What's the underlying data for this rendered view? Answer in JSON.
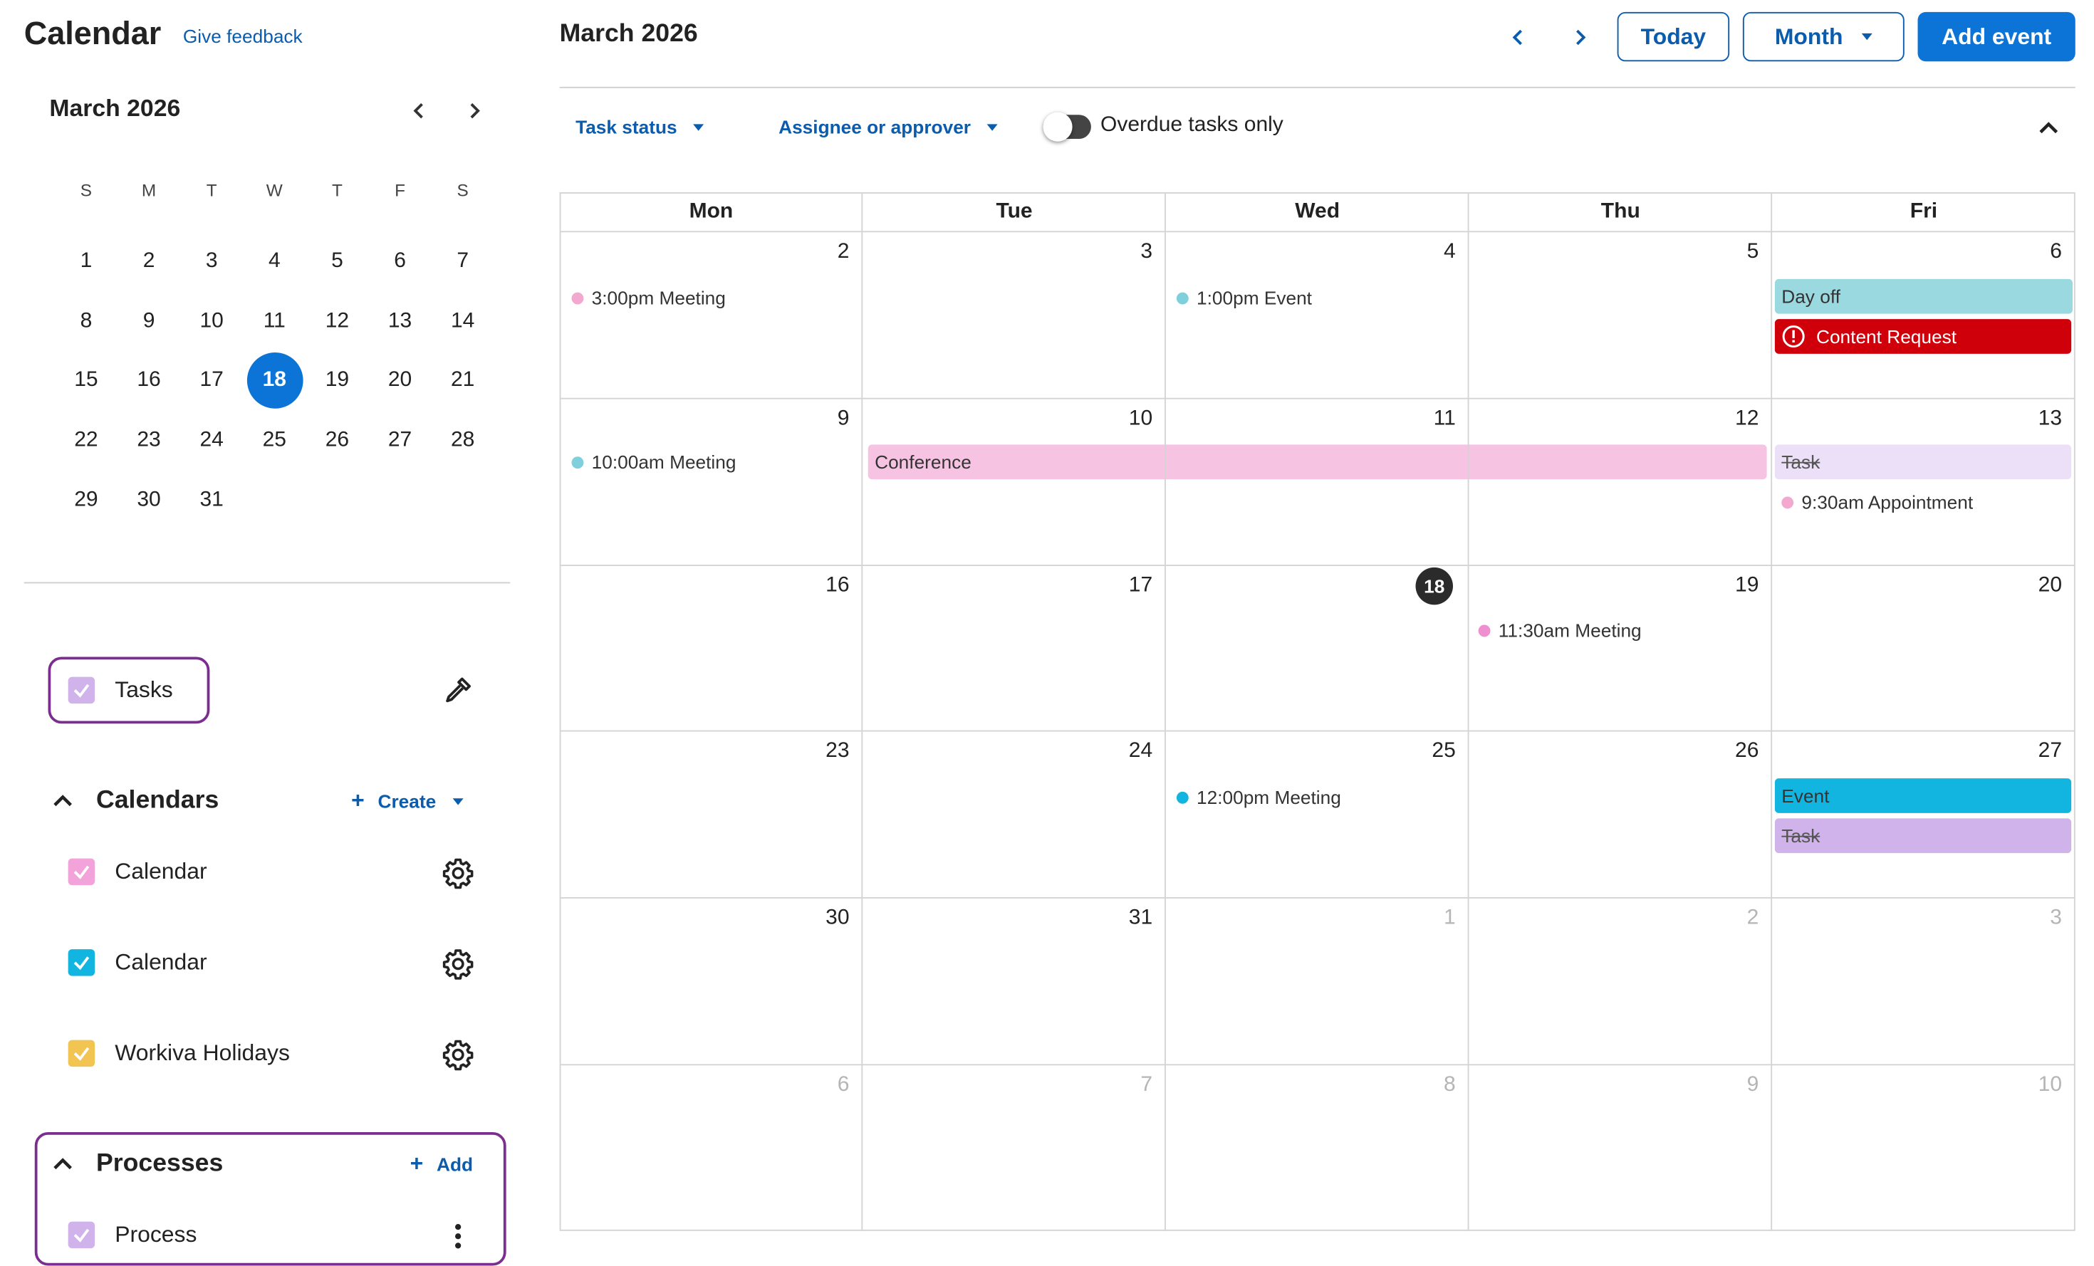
{
  "sidebar": {
    "app_title": "Calendar",
    "feedback_link": "Give feedback",
    "mini_calendar": {
      "title": "March 2026",
      "weekday_headers": [
        "S",
        "M",
        "T",
        "W",
        "T",
        "F",
        "S"
      ],
      "days": [
        "1",
        "2",
        "3",
        "4",
        "5",
        "6",
        "7",
        "8",
        "9",
        "10",
        "11",
        "12",
        "13",
        "14",
        "15",
        "16",
        "17",
        "18",
        "19",
        "20",
        "21",
        "22",
        "23",
        "24",
        "25",
        "26",
        "27",
        "28",
        "29",
        "30",
        "31"
      ],
      "selected_day": "18"
    },
    "tasks": {
      "label": "Tasks",
      "color": "#d1b3ec"
    },
    "calendars": {
      "title": "Calendars",
      "create_label": "Create",
      "items": [
        {
          "label": "Calendar",
          "color": "#f1a3da"
        },
        {
          "label": "Calendar",
          "color": "#12b5e0"
        },
        {
          "label": "Workiva Holidays",
          "color": "#f2c553"
        }
      ]
    },
    "processes": {
      "title": "Processes",
      "add_label": "Add",
      "items": [
        {
          "label": "Process",
          "color": "#d1b3ec"
        }
      ]
    }
  },
  "header": {
    "title": "March 2026",
    "today_label": "Today",
    "view_label": "Month",
    "add_event_label": "Add event"
  },
  "filters": {
    "task_status": "Task status",
    "assignee": "Assignee or approver",
    "overdue_label": "Overdue tasks only",
    "overdue_on": false
  },
  "grid": {
    "weekdays": [
      "Mon",
      "Tue",
      "Wed",
      "Thu",
      "Fri"
    ],
    "weeks": [
      [
        "2",
        "3",
        "4",
        "5",
        "6"
      ],
      [
        "9",
        "10",
        "11",
        "12",
        "13"
      ],
      [
        "16",
        "17",
        "18",
        "19",
        "20"
      ],
      [
        "23",
        "24",
        "25",
        "26",
        "27"
      ],
      [
        "30",
        "31",
        "1",
        "2",
        "3"
      ],
      [
        "6",
        "7",
        "8",
        "9",
        "10"
      ]
    ],
    "today": "18"
  },
  "events": {
    "w1_mon": {
      "label": "3:00pm Meeting",
      "color": "#f3a9cf"
    },
    "w1_wed": {
      "label": "1:00pm Event",
      "color": "#7fcfdc"
    },
    "w1_fri_dayoff": {
      "label": "Day off",
      "color": "#9ad9e0"
    },
    "w1_fri_request": {
      "label": "Content Request",
      "color": "#d0000b"
    },
    "w2_mon": {
      "label": "10:00am Meeting",
      "color": "#7fcfdc"
    },
    "w2_conference": {
      "label": "Conference",
      "color": "#f6c3e3"
    },
    "w2_fri_task": {
      "label": "Task",
      "color": "#ebe0f7"
    },
    "w2_fri_appt": {
      "label": "9:30am Appointment",
      "color": "#f3a9cf"
    },
    "w3_thu": {
      "label": "11:30am Meeting",
      "color": "#ef8fcf"
    },
    "w4_wed": {
      "label": "12:00pm Meeting",
      "color": "#12b5e0"
    },
    "w4_fri_event": {
      "label": "Event",
      "color": "#12b5e0"
    },
    "w4_fri_task": {
      "label": "Task",
      "color": "#d1b3ec"
    }
  }
}
